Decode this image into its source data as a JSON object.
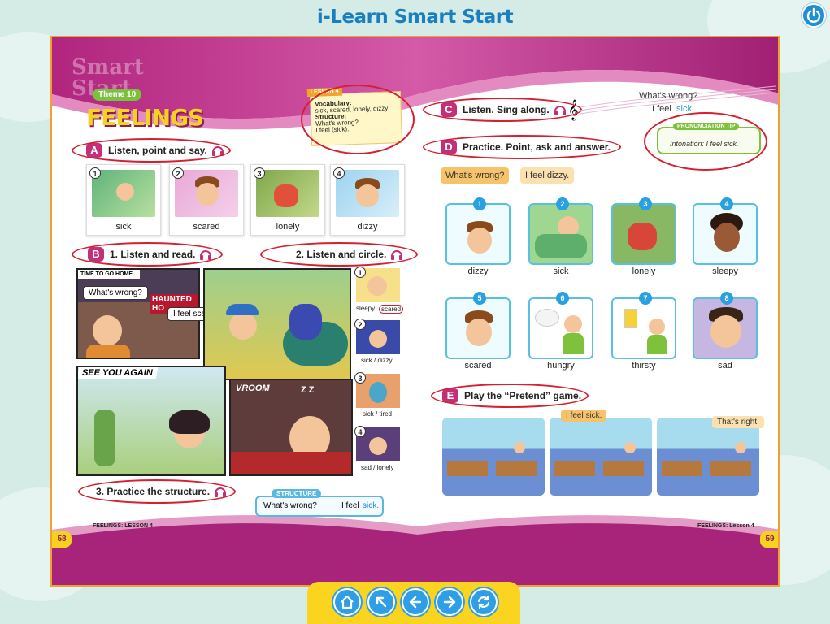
{
  "app": {
    "title": "i-Learn Smart Start"
  },
  "icons": {
    "power": "power-icon",
    "home": "home-icon",
    "up": "arrow-up-left-icon",
    "prev": "arrow-left-icon",
    "next": "arrow-right-icon",
    "refresh": "refresh-icon",
    "headphones": "headphones-icon"
  },
  "colors": {
    "magenta": "#c2307a",
    "title_blue": "#1a7fc1",
    "ring_red": "#d42030",
    "nav_yellow": "#fad41f"
  },
  "left": {
    "brand": "Smart Start",
    "theme": "Theme 10",
    "heading": "FEELINGS",
    "lesson_note": {
      "tag": "LESSON 4",
      "vocab_label": "Vocabulary:",
      "vocab": "sick, scared, lonely, dizzy",
      "structure_label": "Structure:",
      "s1": "What's wrong?",
      "s2": "I feel (sick)."
    },
    "a": {
      "letter": "A",
      "label": "Listen, point and say."
    },
    "a_items": [
      {
        "num": "1",
        "word": "sick"
      },
      {
        "num": "2",
        "word": "scared"
      },
      {
        "num": "3",
        "word": "lonely"
      },
      {
        "num": "4",
        "word": "dizzy"
      }
    ],
    "b": {
      "letter": "B",
      "label": "1. Listen and read.",
      "label2": "2. Listen and circle.",
      "label3": "3. Practice the structure."
    },
    "comic": {
      "banner": "TIME TO GO HOME...",
      "q": "What's wrong?",
      "a": "I feel scared.",
      "sign": "HAUNTED HO",
      "see": "SEE YOU AGAIN",
      "vroom": "VROOM",
      "zz": "Z Z"
    },
    "circle_items": [
      {
        "num": "1",
        "opt_a": "sleepy",
        "opt_b": "scared"
      },
      {
        "num": "2",
        "opt": "sick / dizzy"
      },
      {
        "num": "3",
        "opt": "sick / tired"
      },
      {
        "num": "4",
        "opt": "sad / lonely"
      }
    ],
    "structure": {
      "tag": "STRUCTURE",
      "q": "What's wrong?",
      "a_prefix": "I feel",
      "a_word": "sick."
    },
    "footer": "FEELINGS: LESSON 4",
    "page": "58"
  },
  "right": {
    "c": {
      "letter": "C",
      "label": "Listen. Sing along."
    },
    "song": {
      "l1": "What's wrong?",
      "l2_prefix": "I feel",
      "l2_word": "sick."
    },
    "tip": {
      "tag": "PRONUNCIATION TIP",
      "text": "Intonation: I feel sick."
    },
    "d": {
      "letter": "D",
      "label": "Practice. Point, ask and answer."
    },
    "bubbles": {
      "q": "What's wrong?",
      "a": "I feel dizzy."
    },
    "cards": [
      {
        "num": "1",
        "word": "dizzy"
      },
      {
        "num": "2",
        "word": "sick"
      },
      {
        "num": "3",
        "word": "lonely"
      },
      {
        "num": "4",
        "word": "sleepy"
      },
      {
        "num": "5",
        "word": "scared"
      },
      {
        "num": "6",
        "word": "hungry"
      },
      {
        "num": "7",
        "word": "thirsty"
      },
      {
        "num": "8",
        "word": "sad"
      }
    ],
    "e": {
      "letter": "E",
      "label": "Play the “Pretend” game."
    },
    "game": {
      "b1": "I feel sick.",
      "b2": "That's right!"
    },
    "footer": "FEELINGS: Lesson 4",
    "page": "59"
  }
}
